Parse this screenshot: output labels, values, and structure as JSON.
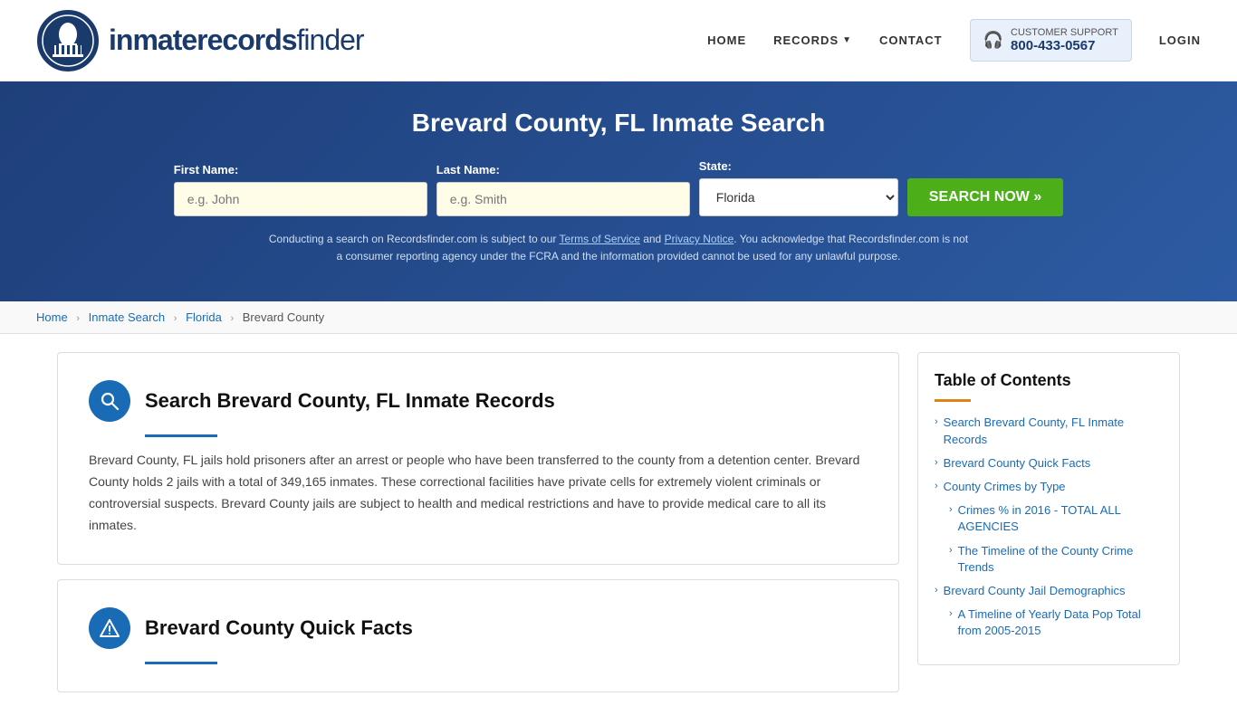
{
  "header": {
    "logo_text_regular": "inmaterecords",
    "logo_text_bold": "finder",
    "nav": {
      "home": "HOME",
      "records": "RECORDS",
      "contact": "CONTACT",
      "login": "LOGIN"
    },
    "support": {
      "label": "CUSTOMER SUPPORT",
      "phone": "800-433-0567"
    }
  },
  "hero": {
    "title": "Brevard County, FL Inmate Search",
    "form": {
      "first_name_label": "First Name:",
      "first_name_placeholder": "e.g. John",
      "last_name_label": "Last Name:",
      "last_name_placeholder": "e.g. Smith",
      "state_label": "State:",
      "state_value": "Florida",
      "search_btn": "SEARCH NOW »"
    },
    "disclaimer": "Conducting a search on Recordsfinder.com is subject to our Terms of Service and Privacy Notice. You acknowledge that Recordsfinder.com is not a consumer reporting agency under the FCRA and the information provided cannot be used for any unlawful purpose."
  },
  "breadcrumb": {
    "home": "Home",
    "inmate_search": "Inmate Search",
    "florida": "Florida",
    "county": "Brevard County"
  },
  "main_section": {
    "title": "Search Brevard County, FL Inmate Records",
    "body": "Brevard County, FL jails hold prisoners after an arrest or people who have been transferred to the county from a detention center. Brevard County holds 2 jails with a total of 349,165 inmates. These correctional facilities have private cells for extremely violent criminals or controversial suspects. Brevard County jails are subject to health and medical restrictions and have to provide medical care to all its inmates."
  },
  "quick_facts_section": {
    "title": "Brevard County Quick Facts"
  },
  "toc": {
    "title": "Table of Contents",
    "items": [
      {
        "label": "Search Brevard County, FL Inmate Records",
        "sub": false
      },
      {
        "label": "Brevard County Quick Facts",
        "sub": false
      },
      {
        "label": "County Crimes by Type",
        "sub": false
      },
      {
        "label": "Crimes % in 2016 - TOTAL ALL AGENCIES",
        "sub": true
      },
      {
        "label": "The Timeline of the County Crime Trends",
        "sub": true
      },
      {
        "label": "Brevard County Jail Demographics",
        "sub": false
      },
      {
        "label": "A Timeline of Yearly Data Pop Total from 2005-2015",
        "sub": true
      }
    ]
  }
}
